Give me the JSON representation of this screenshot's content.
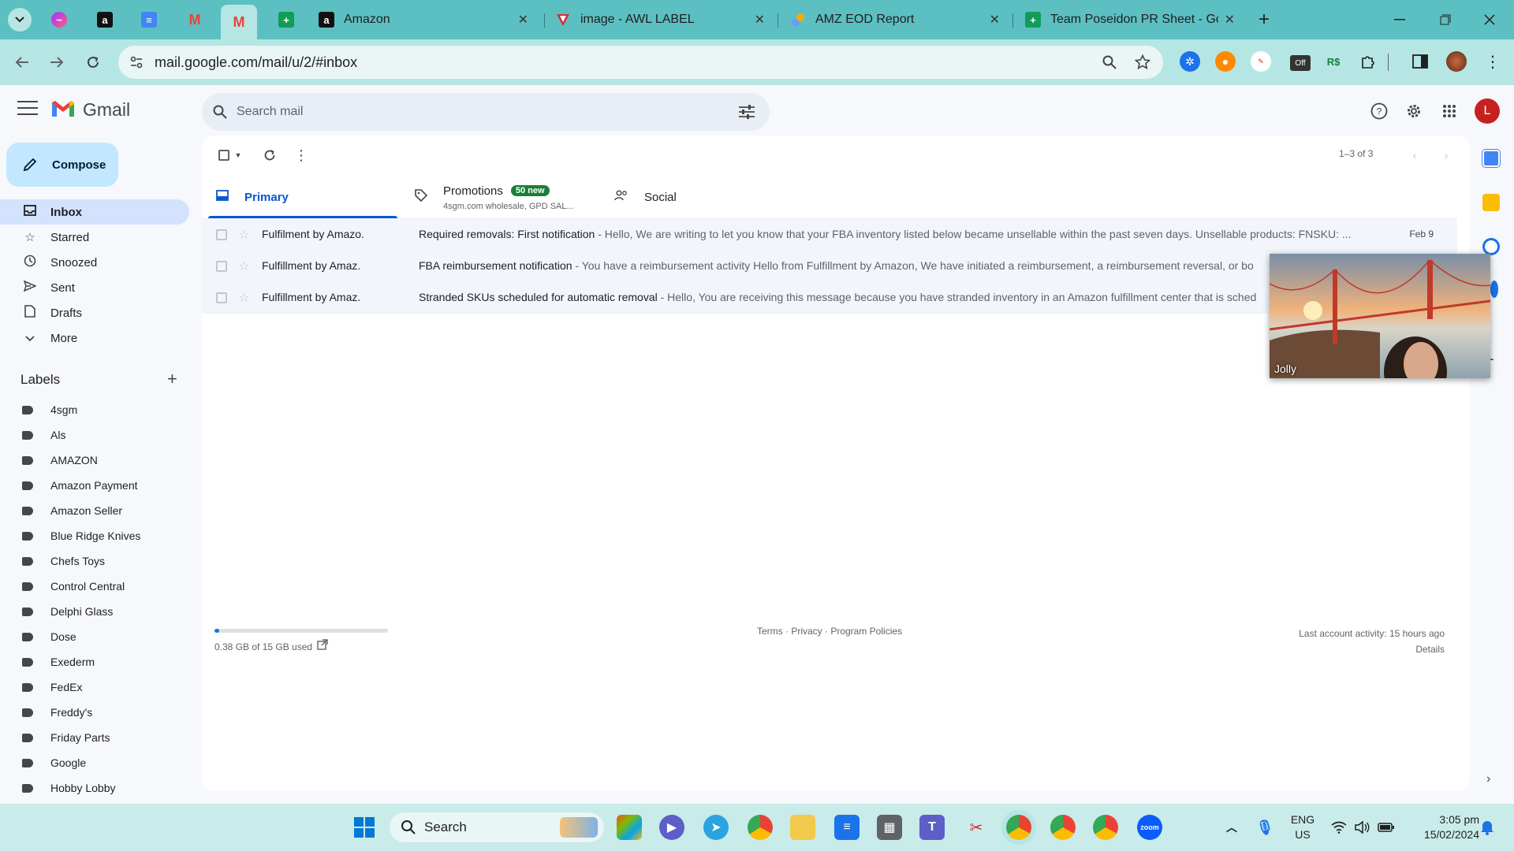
{
  "browser": {
    "tabs": [
      {
        "title": "Amazon",
        "close": "✕"
      },
      {
        "title": "image - AWL LABEL",
        "close": "✕"
      },
      {
        "title": "AMZ EOD Report",
        "close": "✕"
      },
      {
        "title": "Team Poseidon PR Sheet - Goo",
        "close": "✕"
      }
    ],
    "new_tab": "+",
    "url": "mail.google.com/mail/u/2/#inbox",
    "extension_badge": "Off"
  },
  "gmail": {
    "product_name": "Gmail",
    "search_placeholder": "Search mail",
    "avatar_letter": "L",
    "compose_label": "Compose",
    "nav": [
      {
        "label": "Inbox",
        "icon": "inbox-icon"
      },
      {
        "label": "Starred",
        "icon": "star-icon"
      },
      {
        "label": "Snoozed",
        "icon": "clock-icon"
      },
      {
        "label": "Sent",
        "icon": "send-icon"
      },
      {
        "label": "Drafts",
        "icon": "draft-icon"
      },
      {
        "label": "More",
        "icon": "chevron-down-icon"
      }
    ],
    "labels_title": "Labels",
    "labels": [
      "4sgm",
      "Als",
      "AMAZON",
      "Amazon Payment",
      "Amazon Seller",
      "Blue Ridge Knives",
      "Chefs Toys",
      "Control Central",
      "Delphi Glass",
      "Dose",
      "Exederm",
      "FedEx",
      "Freddy's",
      "Friday Parts",
      "Google",
      "Hobby Lobby"
    ],
    "pager": "1–3 of 3",
    "categories": {
      "primary": "Primary",
      "promotions": "Promotions",
      "promotions_badge": "50 new",
      "promotions_sub": "4sgm.com wholesale, GPD SAL...",
      "social": "Social"
    },
    "emails": [
      {
        "sender": "Fulfilment by Amazo.",
        "subject": "Required removals: First notification",
        "snippet": " - Hello, We are writing to let you know that your FBA inventory listed below became unsellable within the past seven days. Unsellable products: FNSKU: ...",
        "date": "Feb 9"
      },
      {
        "sender": "Fulfillment by Amaz.",
        "subject": "FBA reimbursement notification",
        "snippet": " - You have a reimbursement activity Hello from Fulfillment by Amazon, We have initiated a reimbursement, a reimbursement reversal, or bo",
        "date": ""
      },
      {
        "sender": "Fulfillment by Amaz.",
        "subject": "Stranded SKUs scheduled for automatic removal",
        "snippet": " - Hello, You are receiving this message because you have stranded inventory in an Amazon fulfillment center that is sched",
        "date": ""
      }
    ],
    "storage": {
      "text": "0.38 GB of 15 GB used",
      "fraction": 0.025
    },
    "footer_links": "Terms · Privacy · Program Policies",
    "last_activity": "Last account activity: 15 hours ago",
    "details": "Details"
  },
  "video_overlay": {
    "name": "Jolly"
  },
  "taskbar": {
    "search_label": "Search",
    "lang_top": "ENG",
    "lang_bottom": "US",
    "time": "3:05 pm",
    "date": "15/02/2024"
  },
  "colors": {
    "tabstrip": "#5cbfc2",
    "toolbar": "#b6e6e4",
    "accent": "#0b57d0",
    "compose": "#c2e7ff",
    "badge": "#188038"
  }
}
